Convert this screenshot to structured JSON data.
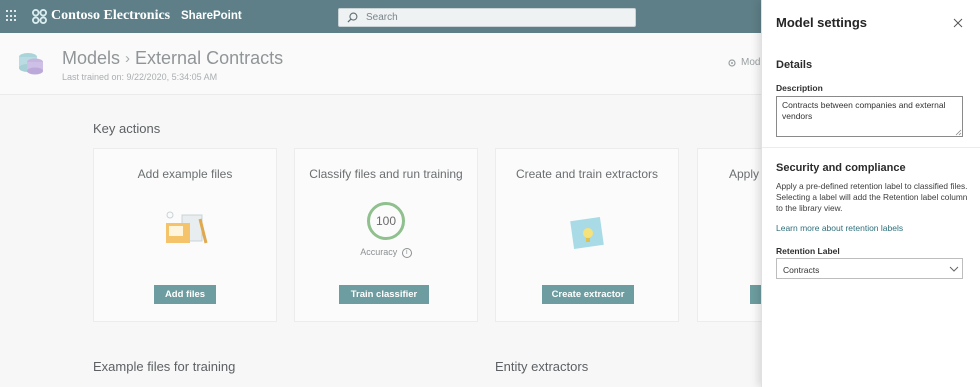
{
  "suite_bar": {
    "brand": "Contoso Electronics",
    "app_link": "SharePoint",
    "search_placeholder": "Search"
  },
  "header": {
    "breadcrumb_root": "Models",
    "breadcrumb_current": "External Contracts",
    "last_trained": "Last trained on: 9/22/2020, 5:34:05 AM",
    "settings_link": "Mod"
  },
  "key_actions": {
    "title": "Key actions",
    "cards": [
      {
        "title": "Add example files",
        "button": "Add files"
      },
      {
        "title": "Classify files and run training",
        "accuracy": "100",
        "accuracy_label": "Accuracy",
        "button": "Train classifier"
      },
      {
        "title": "Create and train extractors",
        "button": "Create extractor"
      },
      {
        "title": "Apply",
        "button": ""
      }
    ]
  },
  "sections": {
    "example_files": "Example files for training",
    "entity_extractors": "Entity extractors"
  },
  "panel": {
    "title": "Model settings",
    "details_heading": "Details",
    "description_label": "Description",
    "description_value": "Contracts between companies and external vendors",
    "security_heading": "Security and compliance",
    "security_text": "Apply a pre-defined retention label to classified files. Selecting a label will add the Retention label column to the library view.",
    "learn_more": "Learn more about retention labels",
    "retention_label": "Retention Label",
    "retention_value": "Contracts"
  },
  "colors": {
    "suite_bar": "#5f7f88",
    "primary_button": "#6d9da0",
    "accuracy_ring": "#8fc08e",
    "link": "#2e6f7a"
  }
}
